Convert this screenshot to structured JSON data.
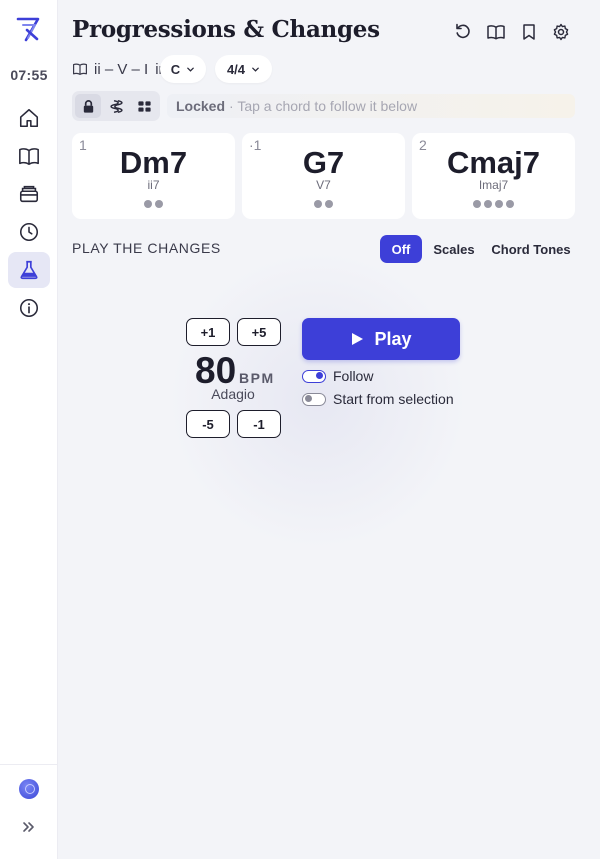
{
  "sidebar": {
    "clock": "07:55",
    "items": [
      {
        "name": "home",
        "icon": "home-icon"
      },
      {
        "name": "library",
        "icon": "book-open-icon"
      },
      {
        "name": "archive",
        "icon": "archive-icon"
      },
      {
        "name": "history",
        "icon": "clock-icon"
      },
      {
        "name": "lab",
        "icon": "flask-icon",
        "active": true
      },
      {
        "name": "info",
        "icon": "info-icon"
      }
    ]
  },
  "header": {
    "title": "Progressions & Changes",
    "actions": [
      "reset-icon",
      "book-open-icon",
      "bookmark-icon",
      "settings-icon"
    ]
  },
  "progression": {
    "name": "ii – V – I",
    "in_label": "in",
    "key": "C",
    "time_signature": "4/4"
  },
  "status": {
    "state": "Locked",
    "hint": "· Tap a chord to follow it below"
  },
  "chords": [
    {
      "index": "1",
      "name": "Dm7",
      "roman": "ii7",
      "beats": 2
    },
    {
      "index": "·1",
      "name": "G7",
      "roman": "V7",
      "beats": 2
    },
    {
      "index": "2",
      "name": "Cmaj7",
      "roman": "Imaj7",
      "beats": 4
    }
  ],
  "play_section": {
    "label": "PLAY THE CHANGES",
    "modes": [
      "Off",
      "Scales",
      "Chord Tones"
    ],
    "active_mode": "Off"
  },
  "tempo": {
    "bpm": "80",
    "unit": "BPM",
    "name": "Adagio",
    "steps": {
      "plus1": "+1",
      "plus5": "+5",
      "minus5": "-5",
      "minus1": "-1"
    }
  },
  "playback": {
    "play_label": "Play",
    "follow_label": "Follow",
    "follow_on": true,
    "start_from_selection_label": "Start from selection",
    "start_from_selection_on": false
  },
  "colors": {
    "accent": "#3d3fd8",
    "background": "#f3f4f8",
    "card": "#ffffff"
  }
}
